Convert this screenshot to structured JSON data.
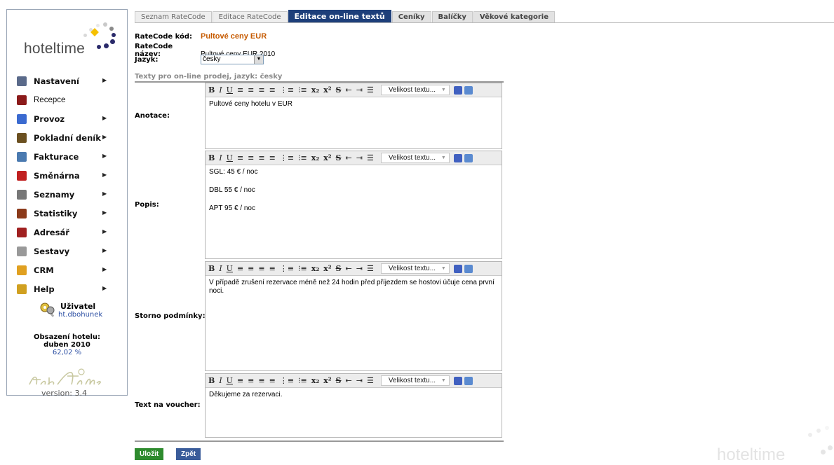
{
  "logo": {
    "brand": "hoteltime"
  },
  "menu": [
    {
      "label": "Nastavení",
      "icon": "settings-icon",
      "color": "#5a6a8a",
      "arrow": true,
      "bold": true
    },
    {
      "label": "Recepce",
      "icon": "reception-icon",
      "color": "#8b1a1a",
      "arrow": false,
      "bold": false
    },
    {
      "label": "Provoz",
      "icon": "operations-icon",
      "color": "#3a6ad0",
      "arrow": true,
      "bold": true
    },
    {
      "label": "Pokladní deník",
      "icon": "cashbook-icon",
      "color": "#6b5020",
      "arrow": true,
      "bold": true
    },
    {
      "label": "Fakturace",
      "icon": "invoice-icon",
      "color": "#4a7ab0",
      "arrow": true,
      "bold": true
    },
    {
      "label": "Směnárna",
      "icon": "exchange-icon",
      "color": "#c02020",
      "arrow": true,
      "bold": true
    },
    {
      "label": "Seznamy",
      "icon": "lists-icon",
      "color": "#777777",
      "arrow": true,
      "bold": true
    },
    {
      "label": "Statistiky",
      "icon": "statistics-icon",
      "color": "#8b3a1a",
      "arrow": true,
      "bold": true
    },
    {
      "label": "Adresář",
      "icon": "address-book-icon",
      "color": "#a02020",
      "arrow": true,
      "bold": true
    },
    {
      "label": "Sestavy",
      "icon": "reports-icon",
      "color": "#999999",
      "arrow": true,
      "bold": true
    },
    {
      "label": "CRM",
      "icon": "crm-icon",
      "color": "#e0a020",
      "arrow": true,
      "bold": true
    },
    {
      "label": "Help",
      "icon": "help-icon",
      "color": "#d0a020",
      "arrow": true,
      "bold": true
    }
  ],
  "menu_arrow": "▶",
  "user": {
    "title": "Uživatel",
    "name": "ht.dbohunek"
  },
  "occupancy": {
    "title": "Obsazení hotelu:",
    "period": "duben 2010",
    "percent": "62,02 %"
  },
  "version": "version: 3.4",
  "tabs": [
    {
      "label": "Seznam RateCode",
      "state": "normal"
    },
    {
      "label": "Editace RateCode",
      "state": "normal"
    },
    {
      "label": "Editace on-line textů",
      "state": "active"
    },
    {
      "label": "Ceníky",
      "state": "dark"
    },
    {
      "label": "Balíčky",
      "state": "dark"
    },
    {
      "label": "Věkové kategorie",
      "state": "dark"
    }
  ],
  "info": {
    "kod_label": "RateCode kód:",
    "kod_value": "Pultové ceny EUR",
    "nazev_label": "RateCode název:",
    "nazev_value": "Pultové ceny EUR 2010",
    "jazyk_label": "Jazyk:",
    "jazyk_value": "česky"
  },
  "section_title": "Texty pro on-line prodej, jazyk: česky",
  "toolbar": {
    "size_placeholder": "Velikost textu..."
  },
  "fields": [
    {
      "label": "Anotace:",
      "lines": [
        "Pultové ceny hotelu v EUR"
      ]
    },
    {
      "label": "Popis:",
      "lines": [
        "SGL: 45 € / noc",
        "DBL 55 € / noc",
        "APT 95 € / noc"
      ]
    },
    {
      "label": "Storno podmínky:",
      "lines": [
        "V případě zrušení rezervace méně než 24 hodin před příjezdem se hostovi účuje cena první noci."
      ]
    },
    {
      "label": "Text na voucher:",
      "lines": [
        "Děkujeme za rezervaci."
      ]
    }
  ],
  "buttons": {
    "save": "Uložit",
    "back": "Zpět"
  },
  "watermark": "hoteltime"
}
